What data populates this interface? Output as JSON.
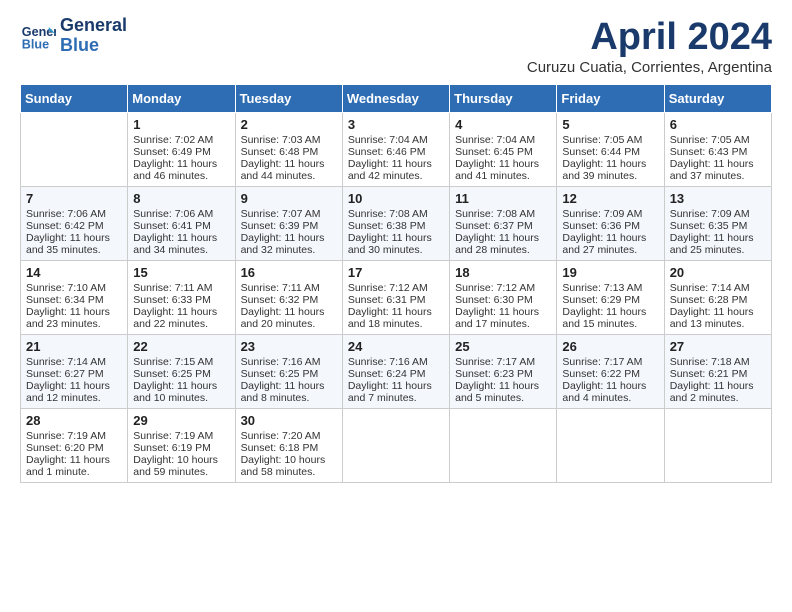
{
  "header": {
    "logo_line1": "General",
    "logo_line2": "Blue",
    "title": "April 2024",
    "subtitle": "Curuzu Cuatia, Corrientes, Argentina"
  },
  "columns": [
    "Sunday",
    "Monday",
    "Tuesday",
    "Wednesday",
    "Thursday",
    "Friday",
    "Saturday"
  ],
  "weeks": [
    [
      {
        "day": "",
        "sunrise": "",
        "sunset": "",
        "daylight": ""
      },
      {
        "day": "1",
        "sunrise": "Sunrise: 7:02 AM",
        "sunset": "Sunset: 6:49 PM",
        "daylight": "Daylight: 11 hours and 46 minutes."
      },
      {
        "day": "2",
        "sunrise": "Sunrise: 7:03 AM",
        "sunset": "Sunset: 6:48 PM",
        "daylight": "Daylight: 11 hours and 44 minutes."
      },
      {
        "day": "3",
        "sunrise": "Sunrise: 7:04 AM",
        "sunset": "Sunset: 6:46 PM",
        "daylight": "Daylight: 11 hours and 42 minutes."
      },
      {
        "day": "4",
        "sunrise": "Sunrise: 7:04 AM",
        "sunset": "Sunset: 6:45 PM",
        "daylight": "Daylight: 11 hours and 41 minutes."
      },
      {
        "day": "5",
        "sunrise": "Sunrise: 7:05 AM",
        "sunset": "Sunset: 6:44 PM",
        "daylight": "Daylight: 11 hours and 39 minutes."
      },
      {
        "day": "6",
        "sunrise": "Sunrise: 7:05 AM",
        "sunset": "Sunset: 6:43 PM",
        "daylight": "Daylight: 11 hours and 37 minutes."
      }
    ],
    [
      {
        "day": "7",
        "sunrise": "Sunrise: 7:06 AM",
        "sunset": "Sunset: 6:42 PM",
        "daylight": "Daylight: 11 hours and 35 minutes."
      },
      {
        "day": "8",
        "sunrise": "Sunrise: 7:06 AM",
        "sunset": "Sunset: 6:41 PM",
        "daylight": "Daylight: 11 hours and 34 minutes."
      },
      {
        "day": "9",
        "sunrise": "Sunrise: 7:07 AM",
        "sunset": "Sunset: 6:39 PM",
        "daylight": "Daylight: 11 hours and 32 minutes."
      },
      {
        "day": "10",
        "sunrise": "Sunrise: 7:08 AM",
        "sunset": "Sunset: 6:38 PM",
        "daylight": "Daylight: 11 hours and 30 minutes."
      },
      {
        "day": "11",
        "sunrise": "Sunrise: 7:08 AM",
        "sunset": "Sunset: 6:37 PM",
        "daylight": "Daylight: 11 hours and 28 minutes."
      },
      {
        "day": "12",
        "sunrise": "Sunrise: 7:09 AM",
        "sunset": "Sunset: 6:36 PM",
        "daylight": "Daylight: 11 hours and 27 minutes."
      },
      {
        "day": "13",
        "sunrise": "Sunrise: 7:09 AM",
        "sunset": "Sunset: 6:35 PM",
        "daylight": "Daylight: 11 hours and 25 minutes."
      }
    ],
    [
      {
        "day": "14",
        "sunrise": "Sunrise: 7:10 AM",
        "sunset": "Sunset: 6:34 PM",
        "daylight": "Daylight: 11 hours and 23 minutes."
      },
      {
        "day": "15",
        "sunrise": "Sunrise: 7:11 AM",
        "sunset": "Sunset: 6:33 PM",
        "daylight": "Daylight: 11 hours and 22 minutes."
      },
      {
        "day": "16",
        "sunrise": "Sunrise: 7:11 AM",
        "sunset": "Sunset: 6:32 PM",
        "daylight": "Daylight: 11 hours and 20 minutes."
      },
      {
        "day": "17",
        "sunrise": "Sunrise: 7:12 AM",
        "sunset": "Sunset: 6:31 PM",
        "daylight": "Daylight: 11 hours and 18 minutes."
      },
      {
        "day": "18",
        "sunrise": "Sunrise: 7:12 AM",
        "sunset": "Sunset: 6:30 PM",
        "daylight": "Daylight: 11 hours and 17 minutes."
      },
      {
        "day": "19",
        "sunrise": "Sunrise: 7:13 AM",
        "sunset": "Sunset: 6:29 PM",
        "daylight": "Daylight: 11 hours and 15 minutes."
      },
      {
        "day": "20",
        "sunrise": "Sunrise: 7:14 AM",
        "sunset": "Sunset: 6:28 PM",
        "daylight": "Daylight: 11 hours and 13 minutes."
      }
    ],
    [
      {
        "day": "21",
        "sunrise": "Sunrise: 7:14 AM",
        "sunset": "Sunset: 6:27 PM",
        "daylight": "Daylight: 11 hours and 12 minutes."
      },
      {
        "day": "22",
        "sunrise": "Sunrise: 7:15 AM",
        "sunset": "Sunset: 6:25 PM",
        "daylight": "Daylight: 11 hours and 10 minutes."
      },
      {
        "day": "23",
        "sunrise": "Sunrise: 7:16 AM",
        "sunset": "Sunset: 6:25 PM",
        "daylight": "Daylight: 11 hours and 8 minutes."
      },
      {
        "day": "24",
        "sunrise": "Sunrise: 7:16 AM",
        "sunset": "Sunset: 6:24 PM",
        "daylight": "Daylight: 11 hours and 7 minutes."
      },
      {
        "day": "25",
        "sunrise": "Sunrise: 7:17 AM",
        "sunset": "Sunset: 6:23 PM",
        "daylight": "Daylight: 11 hours and 5 minutes."
      },
      {
        "day": "26",
        "sunrise": "Sunrise: 7:17 AM",
        "sunset": "Sunset: 6:22 PM",
        "daylight": "Daylight: 11 hours and 4 minutes."
      },
      {
        "day": "27",
        "sunrise": "Sunrise: 7:18 AM",
        "sunset": "Sunset: 6:21 PM",
        "daylight": "Daylight: 11 hours and 2 minutes."
      }
    ],
    [
      {
        "day": "28",
        "sunrise": "Sunrise: 7:19 AM",
        "sunset": "Sunset: 6:20 PM",
        "daylight": "Daylight: 11 hours and 1 minute."
      },
      {
        "day": "29",
        "sunrise": "Sunrise: 7:19 AM",
        "sunset": "Sunset: 6:19 PM",
        "daylight": "Daylight: 10 hours and 59 minutes."
      },
      {
        "day": "30",
        "sunrise": "Sunrise: 7:20 AM",
        "sunset": "Sunset: 6:18 PM",
        "daylight": "Daylight: 10 hours and 58 minutes."
      },
      {
        "day": "",
        "sunrise": "",
        "sunset": "",
        "daylight": ""
      },
      {
        "day": "",
        "sunrise": "",
        "sunset": "",
        "daylight": ""
      },
      {
        "day": "",
        "sunrise": "",
        "sunset": "",
        "daylight": ""
      },
      {
        "day": "",
        "sunrise": "",
        "sunset": "",
        "daylight": ""
      }
    ]
  ]
}
